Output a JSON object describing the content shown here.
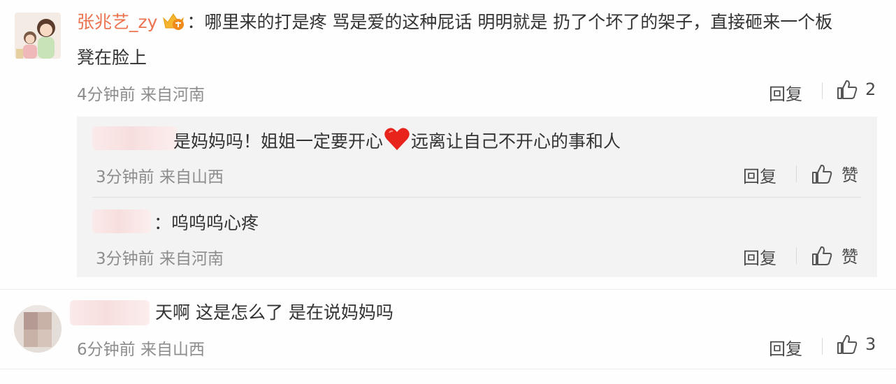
{
  "comments": [
    {
      "author": "张兆艺_zy",
      "separator": "：",
      "text_line1": "哪里来的打是疼 骂是爱的这种屁话 明明就是 扔了个坏了的架子，直接砸来一个板",
      "text_line2": "凳在脸上",
      "time": "4分钟前",
      "location": "来自河南",
      "reply_label": "回复",
      "like_count": "2",
      "replies": [
        {
          "text_before": "是妈妈吗！姐姐一定要开心",
          "text_after": "远离让自己不开心的事和人",
          "time": "3分钟前",
          "location": "来自山西",
          "reply_label": "回复",
          "like_label": "赞"
        },
        {
          "separator": "：",
          "text": "呜呜呜心疼",
          "time": "3分钟前",
          "location": "来自河南",
          "reply_label": "回复",
          "like_label": "赞"
        }
      ]
    },
    {
      "text": "天啊 这是怎么了 是在说妈妈吗",
      "time": "6分钟前",
      "location": "来自山西",
      "reply_label": "回复",
      "like_count": "3"
    }
  ],
  "icons": {
    "vip_badge": "crown-badge-icon",
    "like": "thumbs-up-icon",
    "emoji": "red-heart-icon"
  },
  "colors": {
    "author": "#eb7350",
    "text": "#333333",
    "meta": "#8d8d8d",
    "heart": "#e8231b"
  }
}
